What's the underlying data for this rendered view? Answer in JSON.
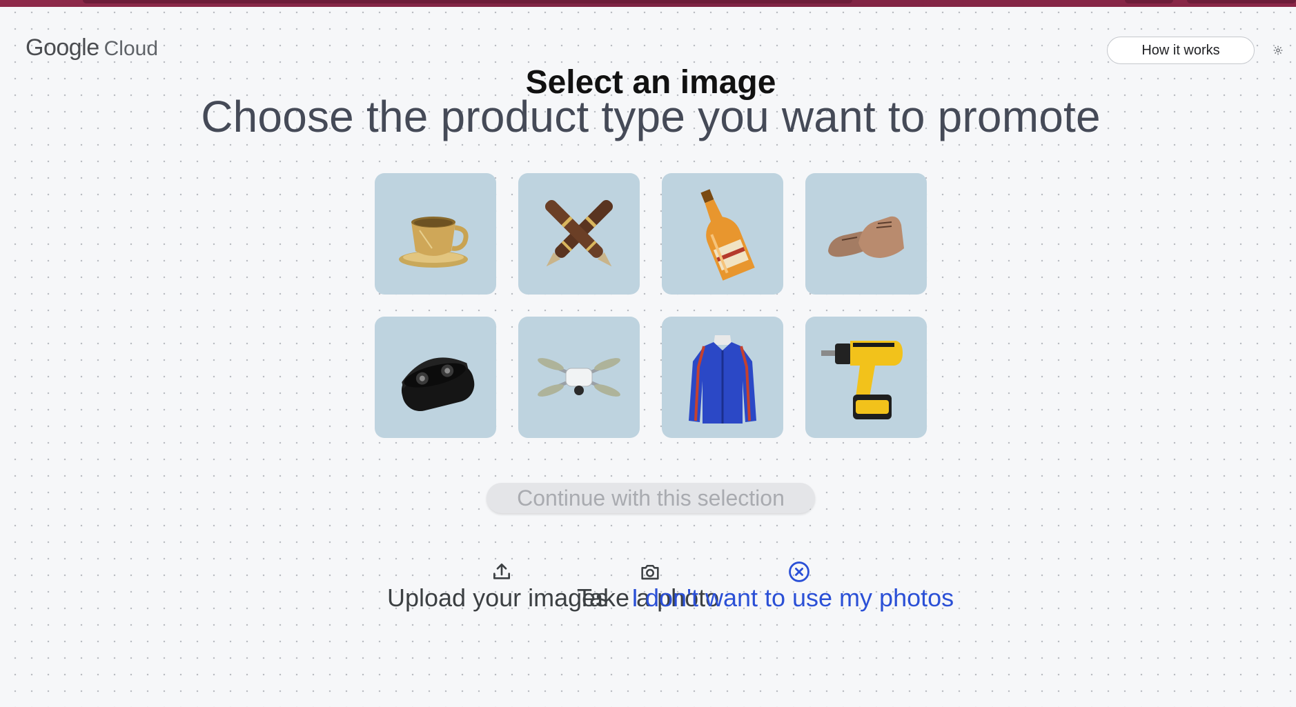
{
  "brand": {
    "google": "Google",
    "cloud": "Cloud"
  },
  "header": {
    "how_it_works": "How it works",
    "settings_icon": "settings-gear-icon"
  },
  "heading": {
    "title": "Select an image",
    "subtitle": "Choose the product type you want to promote"
  },
  "products": [
    {
      "name": "teacup",
      "icon": "teacup-icon"
    },
    {
      "name": "fountain-pens",
      "icon": "fountain-pens-icon"
    },
    {
      "name": "champagne-bottle",
      "icon": "bottle-icon"
    },
    {
      "name": "leather-shoes",
      "icon": "shoes-icon"
    },
    {
      "name": "wireless-earbuds",
      "icon": "earbuds-icon"
    },
    {
      "name": "drone",
      "icon": "drone-icon"
    },
    {
      "name": "athletic-jacket",
      "icon": "jacket-icon"
    },
    {
      "name": "power-drill",
      "icon": "drill-icon"
    }
  ],
  "continue_button": {
    "label": "Continue with this selection"
  },
  "actions": {
    "upload": {
      "label": "Upload your images",
      "icon": "upload-icon"
    },
    "photo": {
      "label": "Take a photo",
      "icon": "camera-icon"
    },
    "no_photos": {
      "label": "I don't want to use my photos",
      "icon": "close-circle-icon"
    }
  },
  "colors": {
    "accent": "#2b50d6",
    "tile_bg": "#bed3df",
    "top_strip": "#8a2747",
    "disabled_text": "#a9abb0"
  }
}
